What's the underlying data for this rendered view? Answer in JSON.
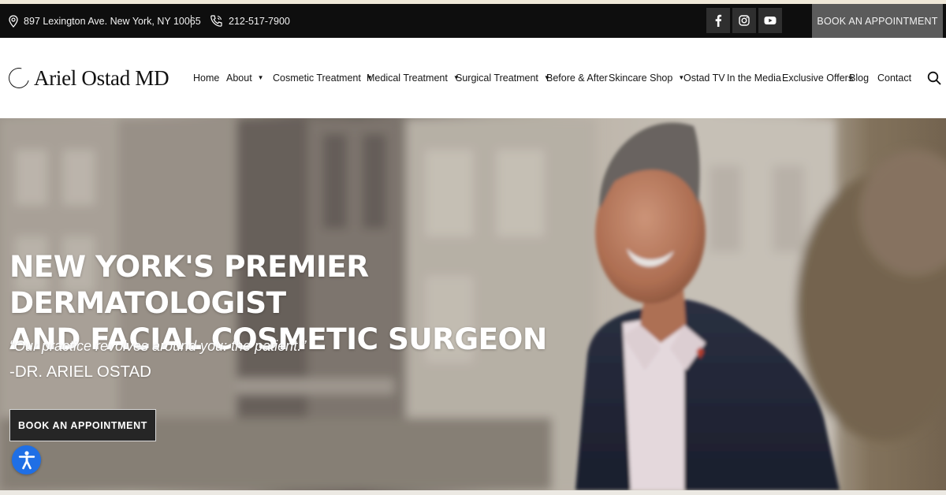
{
  "topbar": {
    "address": "897 Lexington Ave. New York, NY 10065",
    "separator": "|",
    "phone": "212-517-7900",
    "social": [
      "facebook-icon",
      "instagram-icon",
      "youtube-icon"
    ],
    "book_label": "BOOK AN APPOINTMENT"
  },
  "header": {
    "logo_text": "Ariel Ostad MD",
    "nav": [
      {
        "label": "Home",
        "dropdown": false
      },
      {
        "label": "About",
        "dropdown": true
      },
      {
        "label": "Cosmetic Treatment",
        "dropdown": true
      },
      {
        "label": "Medical Treatment",
        "dropdown": true
      },
      {
        "label": "Surgical Treatment",
        "dropdown": true
      },
      {
        "label": "Before & After",
        "dropdown": false
      },
      {
        "label": "Skincare Shop",
        "dropdown": true
      },
      {
        "label": "Ostad TV",
        "dropdown": false
      },
      {
        "label": "In the Media",
        "dropdown": false
      },
      {
        "label": "Exclusive Offers",
        "dropdown": false
      },
      {
        "label": "Blog",
        "dropdown": false
      },
      {
        "label": "Contact",
        "dropdown": false
      }
    ],
    "caret": "▼"
  },
  "hero": {
    "title_line1": "NEW YORK'S PREMIER DERMATOLOGIST",
    "title_line2": "AND FACIAL COSMETIC SURGEON",
    "quote": "“Our practice revolves around you: the patient.”",
    "signature": "-DR. ARIEL OSTAD",
    "book_label": "BOOK AN APPOINTMENT"
  },
  "colors": {
    "topbar_bg": "#0e0e0e",
    "book_top_bg": "#5b5b5b",
    "hero_button_bg": "#262626",
    "accessibility_blue": "#1f6fe5"
  }
}
